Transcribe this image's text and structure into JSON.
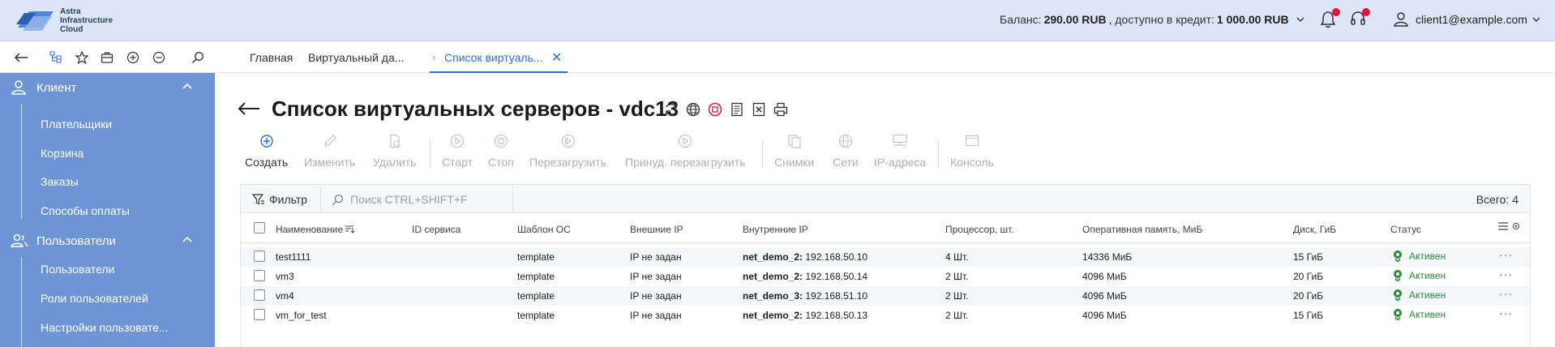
{
  "header": {
    "logo_text": [
      "Astra",
      "Infrastructure",
      "Cloud"
    ],
    "balance_label": "Баланс:",
    "balance_value": "290.00 RUB",
    "credit_label": ",  доступно в кредит:",
    "credit_value": "1 000.00 RUB",
    "user_email": "client1@example.com"
  },
  "toolbar_icons": [
    "back-arrow-icon",
    "tree-icon",
    "star-icon",
    "briefcase-icon",
    "plus-circle-icon",
    "minus-circle-icon",
    "search-icon"
  ],
  "tabs": [
    {
      "label": "Главная"
    },
    {
      "label": "Виртуальный да..."
    },
    {
      "label": "Список виртуаль..."
    }
  ],
  "sidebar": {
    "groups": [
      {
        "label": "Клиент",
        "icon": "client-icon",
        "items": [
          "Плательщики",
          "Корзина",
          "Заказы",
          "Способы оплаты"
        ]
      },
      {
        "label": "Пользователи",
        "icon": "users-icon",
        "items": [
          "Пользователи",
          "Роли пользователей",
          "Настройки пользовате..."
        ]
      }
    ]
  },
  "page": {
    "title": "Список виртуальных серверов - vdc13",
    "title_icons": [
      "refresh-icon",
      "globe-icon",
      "stop-icon",
      "report-icon",
      "excel-icon",
      "print-icon"
    ]
  },
  "actions": {
    "create": "Создать",
    "edit": "Изменить",
    "delete": "Удалить",
    "start": "Старт",
    "stop": "Стоп",
    "restart": "Перезагрузить",
    "force_restart": "Принуд. перезагрузить",
    "snapshots": "Снимки",
    "networks": "Сети",
    "ip": "IP-адреса",
    "console": "Консоль"
  },
  "filter": {
    "label": "Фильтр",
    "search_placeholder": "Поиск CTRL+SHIFT+F",
    "total": "Всего: 4"
  },
  "table": {
    "columns": {
      "name": "Наименование",
      "service_id": "ID сервиса",
      "os": "Шаблон ОС",
      "ext_ip": "Внешние IP",
      "int_ip": "Внутренние IP",
      "cpu": "Процессор, шт.",
      "ram": "Оперативная память, МиБ",
      "disk": "Диск, ГиБ",
      "status": "Статус"
    },
    "rows": [
      {
        "name": "test1111",
        "os": "template",
        "ext_ip": "IP не задан",
        "net": "net_demo_2:",
        "ip": " 192.168.50.10",
        "cpu": "4 Шт.",
        "ram": "14336 МиБ",
        "disk": "15 ГиБ",
        "status": "Активен"
      },
      {
        "name": "vm3",
        "os": "template",
        "ext_ip": "IP не задан",
        "net": "net_demo_2:",
        "ip": " 192.168.50.14",
        "cpu": "2 Шт.",
        "ram": "4096 МиБ",
        "disk": "20 ГиБ",
        "status": "Активен"
      },
      {
        "name": "vm4",
        "os": "template",
        "ext_ip": "IP не задан",
        "net": "net_demo_3:",
        "ip": " 192.168.51.10",
        "cpu": "2 Шт.",
        "ram": "4096 МиБ",
        "disk": "20 ГиБ",
        "status": "Активен"
      },
      {
        "name": "vm_for_test",
        "os": "template",
        "ext_ip": "IP не задан",
        "net": "net_demo_2:",
        "ip": " 192.168.50.13",
        "cpu": "2 Шт.",
        "ram": "4096 МиБ",
        "disk": "15 ГиБ",
        "status": "Активен"
      }
    ],
    "more_label": "···"
  },
  "colors": {
    "sidebar": "#6d95d6",
    "header": "#dde6f6",
    "accent": "#2f6fd6",
    "status_active": "#2e8b3a",
    "badge": "#e0163c"
  }
}
